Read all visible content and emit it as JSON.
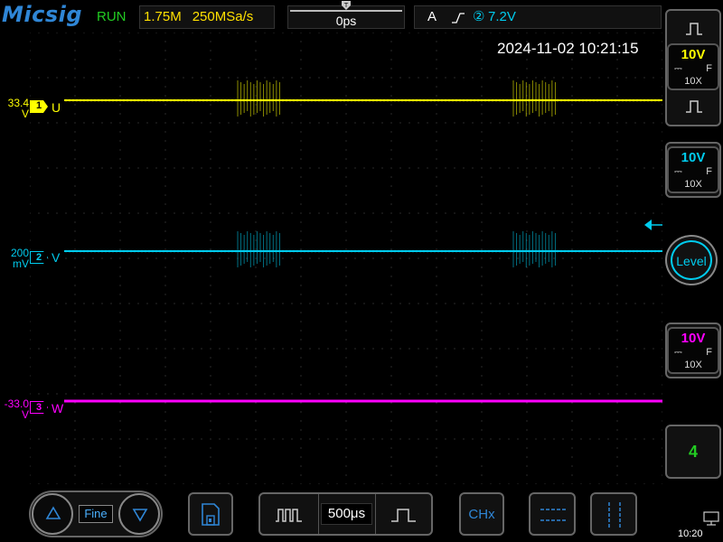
{
  "header": {
    "brand": "Micsig",
    "status": "RUN",
    "memory_depth": "1.75M",
    "sample_rate": "250MSa/s",
    "horizontal_position": "0ps",
    "trigger_mode": "A",
    "trigger_channel": "②",
    "trigger_level": "7.2V"
  },
  "timestamp": "2024-11-02 10:21:15",
  "channels": [
    {
      "id": "1",
      "name": "U",
      "offset_value": "33.4",
      "offset_unit": "V",
      "color": "#ffff00",
      "scale": "10V",
      "probe": "10X",
      "coupling": "F"
    },
    {
      "id": "2",
      "name": "V",
      "offset_value": "200",
      "offset_unit": "mV",
      "color": "#00ccee",
      "scale": "10V",
      "probe": "10X",
      "coupling": "F"
    },
    {
      "id": "3",
      "name": "W",
      "offset_value": "-33.0",
      "offset_unit": "V",
      "color": "#ff00ff",
      "scale": "10V",
      "probe": "10X",
      "coupling": "F"
    }
  ],
  "right_panel": {
    "level_label": "Level",
    "channel_count": "4"
  },
  "bottom_bar": {
    "fine_label": "Fine",
    "timebase": "500μs",
    "chx_label": "CHx",
    "clock": "10:20"
  },
  "icons": {
    "up": "up-arrow-icon",
    "down": "down-arrow-icon",
    "save": "save-icon",
    "pulse": "pulse-icon",
    "cursor_h": "horizontal-cursor-icon",
    "cursor_v": "vertical-cursor-icon",
    "network": "network-icon"
  }
}
